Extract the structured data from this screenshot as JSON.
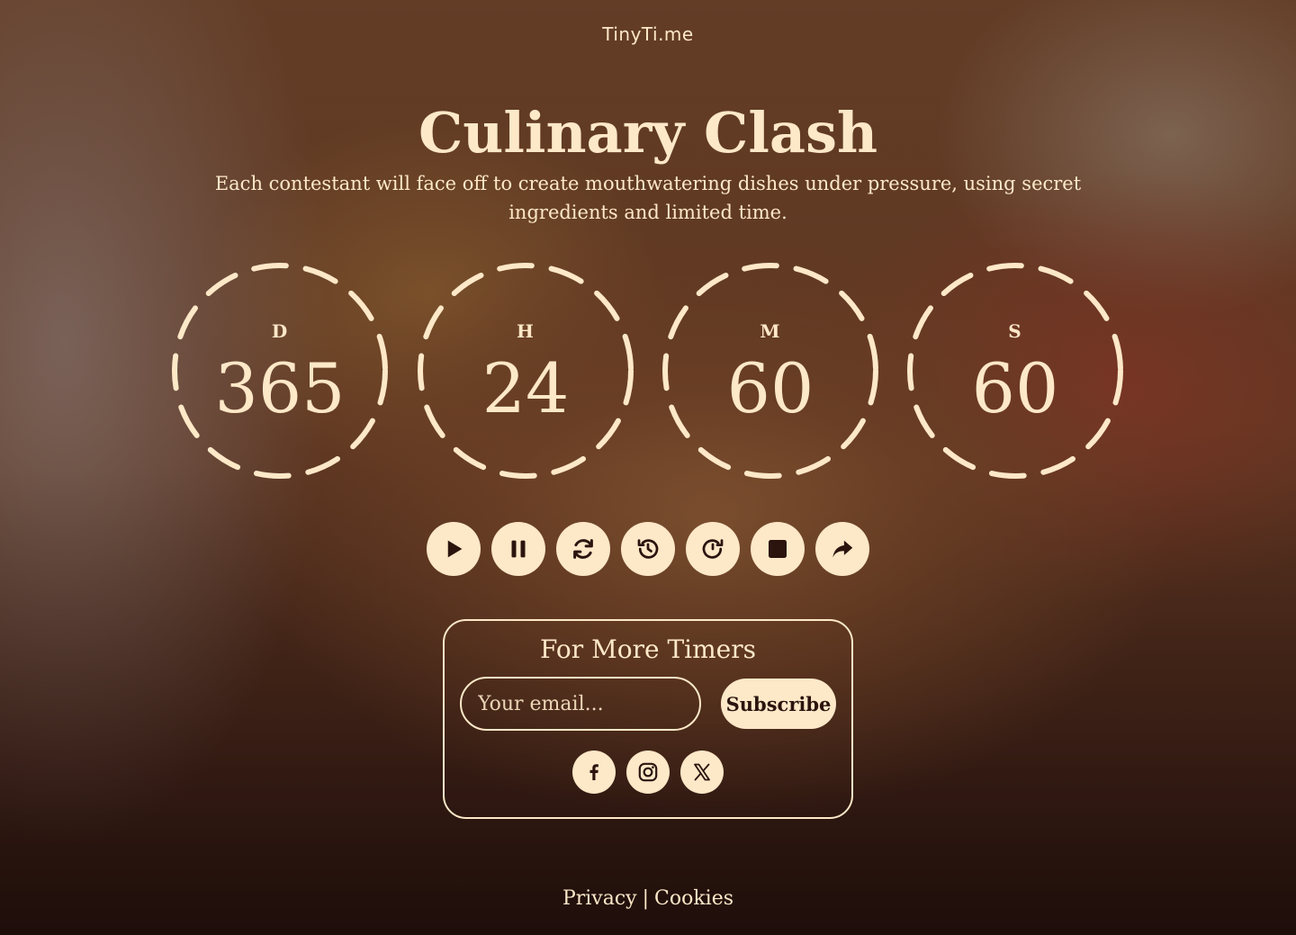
{
  "brand": "TinyTi.me",
  "event": {
    "title": "Culinary Clash",
    "description": "Each contestant will face off to create mouthwatering dishes under pressure, using secret ingredients and limited time."
  },
  "timer": {
    "units": [
      {
        "label": "D",
        "value": "365"
      },
      {
        "label": "H",
        "value": "24"
      },
      {
        "label": "M",
        "value": "60"
      },
      {
        "label": "S",
        "value": "60"
      }
    ]
  },
  "controls": [
    {
      "name": "play",
      "icon": "play-icon"
    },
    {
      "name": "pause",
      "icon": "pause-icon"
    },
    {
      "name": "restart",
      "icon": "refresh-icon"
    },
    {
      "name": "rewind",
      "icon": "history-icon"
    },
    {
      "name": "forward",
      "icon": "clock-forward-icon"
    },
    {
      "name": "stop",
      "icon": "stop-icon"
    },
    {
      "name": "share",
      "icon": "share-icon"
    }
  ],
  "subscribe": {
    "heading": "For More Timers",
    "email_placeholder": "Your email...",
    "email_value": "",
    "button_label": "Subscribe"
  },
  "social": [
    {
      "name": "facebook",
      "icon": "facebook-icon"
    },
    {
      "name": "instagram",
      "icon": "instagram-icon"
    },
    {
      "name": "x",
      "icon": "x-icon"
    }
  ],
  "footer": {
    "privacy": "Privacy",
    "separator": "|",
    "cookies": "Cookies"
  },
  "colors": {
    "accent": "#fde8c8",
    "icon_dark": "#2b140e"
  }
}
